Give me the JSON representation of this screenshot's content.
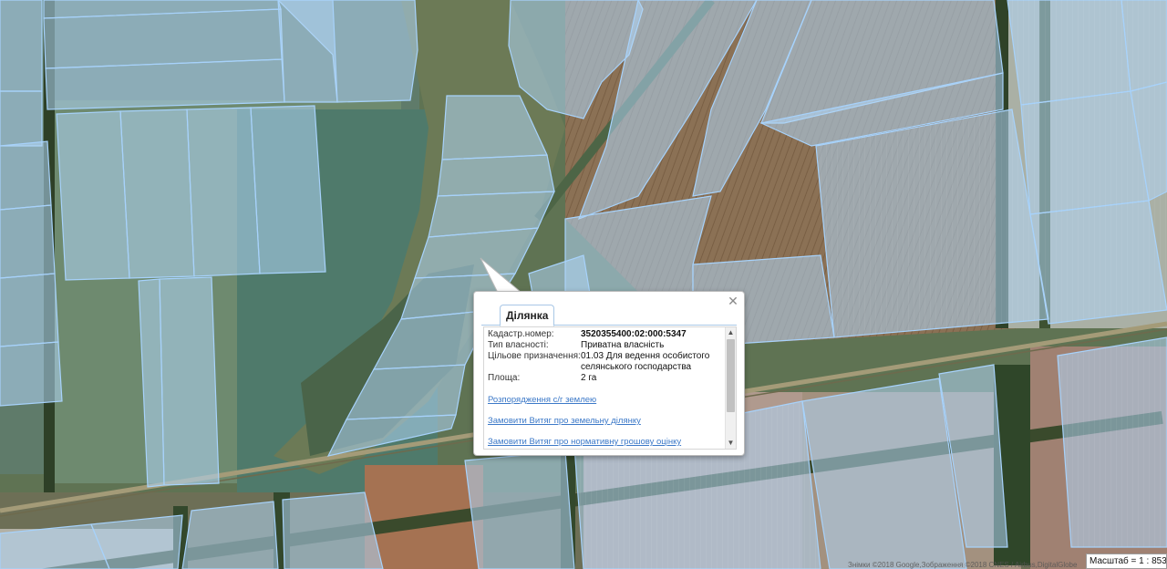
{
  "map": {
    "imagery_type": "satellite",
    "overlay_color": "#a9cff2",
    "overlay_stroke": "#9fcbf5",
    "road_color": "#8b8560"
  },
  "popup": {
    "tab_label": "Ділянка",
    "close_icon": "close-icon",
    "fields": [
      {
        "label": "Кадастр.номер:",
        "value": "3520355400:02:000:5347"
      },
      {
        "label": "Тип власності:",
        "value": "Приватна власність"
      },
      {
        "label": "Цільове призначення:",
        "value": "01.03 Для ведення особистого селянського господарства"
      },
      {
        "label": "Площа:",
        "value": "2 га"
      }
    ],
    "links": [
      "Розпорядження с/г землею",
      "Замовити Витяг про земельну ділянку",
      "Замовити Витяг про нормативну грошову оцінку"
    ]
  },
  "attribution": "Знімки ©2018 Google,Зображення ©2018 CNES / Airbus,DigitalGlobe",
  "scale": {
    "label": "Масштаб = 1 : 8531"
  }
}
